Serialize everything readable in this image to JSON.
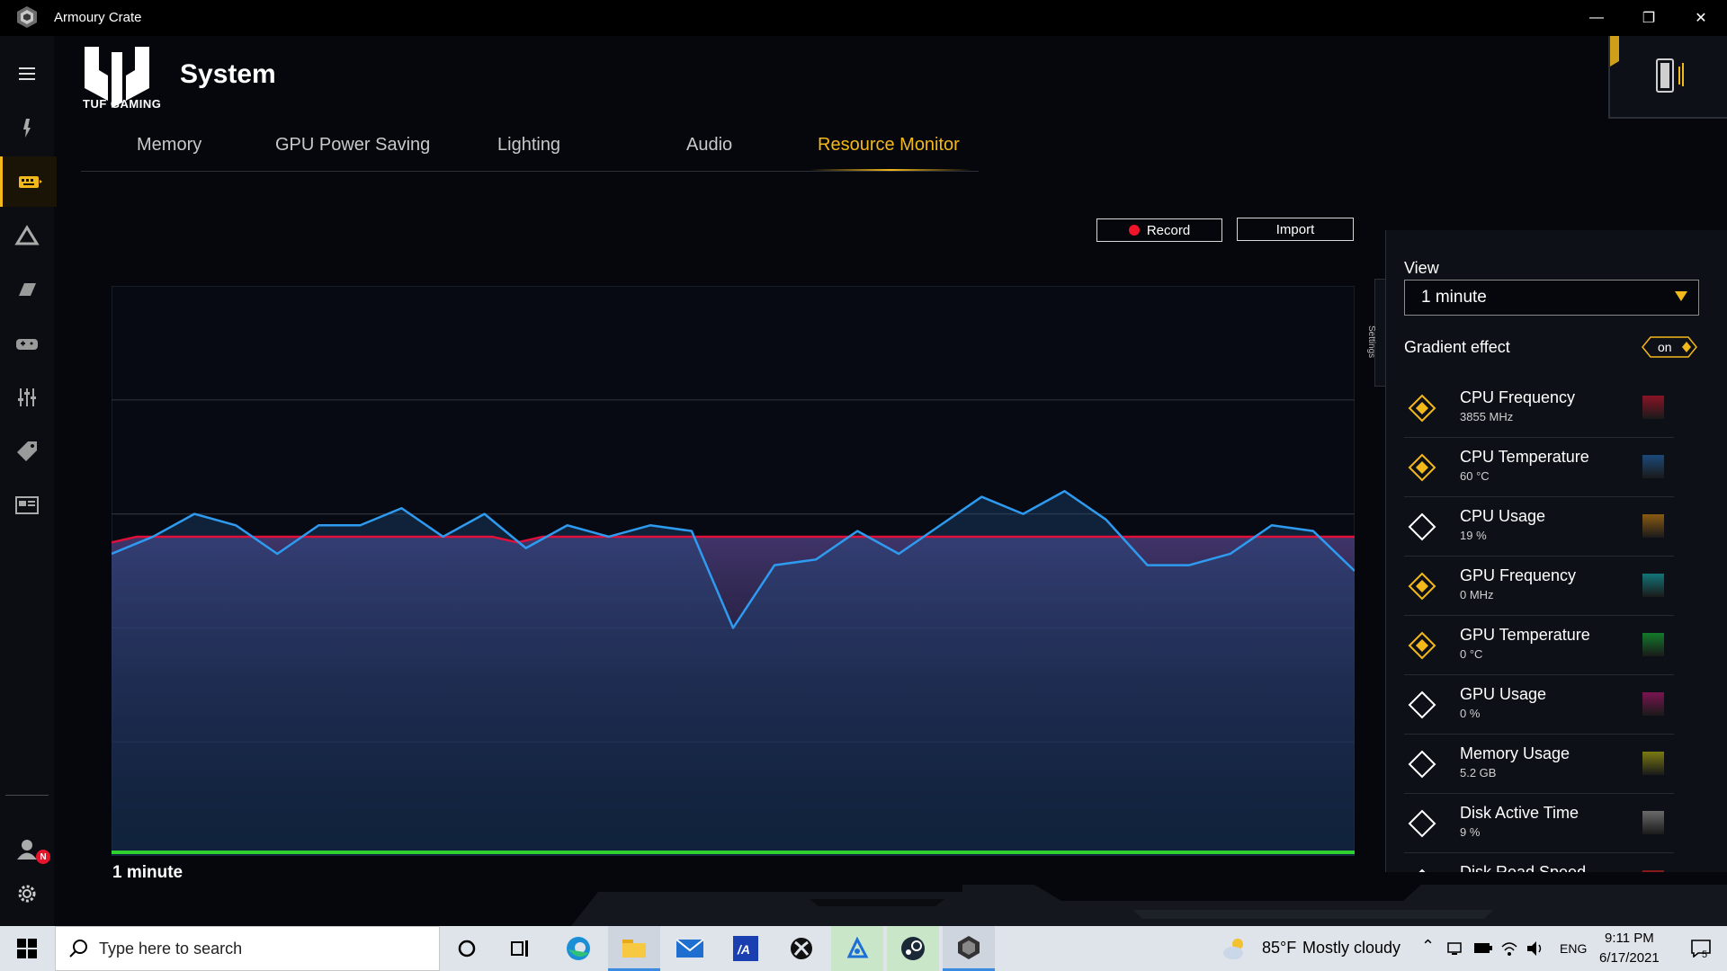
{
  "window": {
    "title": "Armoury Crate",
    "minimize": "—",
    "maximize": "❐",
    "close": "✕"
  },
  "header": {
    "brand": "TUF GAMING",
    "title": "System"
  },
  "tabs": [
    {
      "label": "Memory"
    },
    {
      "label": "GPU Power Saving"
    },
    {
      "label": "Lighting"
    },
    {
      "label": "Audio"
    },
    {
      "label": "Resource Monitor",
      "active": true
    }
  ],
  "toolbar": {
    "record_label": "Record",
    "import_label": "Import"
  },
  "chart": {
    "time_label": "1 minute"
  },
  "chart_data": {
    "type": "area",
    "series": [
      {
        "color": "#e0103a",
        "values": [
          55,
          56,
          56,
          56,
          56,
          56,
          56,
          56,
          56,
          56,
          56,
          56,
          56,
          56,
          56,
          56,
          55,
          56,
          56,
          56,
          56,
          56,
          56,
          56,
          56,
          56,
          56,
          56,
          56,
          56,
          56,
          56,
          56,
          56,
          56,
          56,
          56,
          56,
          56,
          56,
          56,
          56,
          56,
          56,
          56,
          56,
          56,
          56,
          56,
          56
        ]
      },
      {
        "color": "#2e9bf0",
        "values": [
          53,
          56,
          60,
          58,
          53,
          58,
          58,
          61,
          56,
          60,
          54,
          58,
          56,
          58,
          57,
          40,
          51,
          52,
          57,
          53,
          58,
          63,
          60,
          64,
          59,
          51,
          51,
          53,
          58,
          57,
          50
        ]
      }
    ],
    "gridlines": 4,
    "colors": {
      "red": "#e0103a",
      "blue": "#2e9bf0",
      "pink": "#d0306a"
    }
  },
  "panel": {
    "tab_label": "Settings",
    "view_label": "View",
    "view_value": "1  minute",
    "gradient_label": "Gradient effect",
    "gradient_state": "on",
    "metrics": [
      {
        "name": "CPU Frequency",
        "value": "3855 MHz",
        "selected": true,
        "color": "#8a1426"
      },
      {
        "name": "CPU Temperature",
        "value": "60 °C",
        "selected": true,
        "color": "#1a4a7a"
      },
      {
        "name": "CPU Usage",
        "value": "19 %",
        "selected": false,
        "color": "#8a5a12"
      },
      {
        "name": "GPU Frequency",
        "value": "0 MHz",
        "selected": true,
        "color": "#127478"
      },
      {
        "name": "GPU Temperature",
        "value": "0 °C",
        "selected": true,
        "color": "#127a2a"
      },
      {
        "name": "GPU Usage",
        "value": "0 %",
        "selected": false,
        "color": "#7a1450"
      },
      {
        "name": "Memory Usage",
        "value": "5.2 GB",
        "selected": false,
        "color": "#7a7a12"
      },
      {
        "name": "Disk Active Time",
        "value": "9 %",
        "selected": false,
        "color": "#6a6a6a"
      },
      {
        "name": "Disk Read Speed",
        "value": "",
        "selected": false,
        "color": "#8a1a1a"
      }
    ]
  },
  "notification_badge": "N",
  "taskbar": {
    "search_placeholder": "Type here to search",
    "weather_temp": "85°F",
    "weather_text": "Mostly cloudy",
    "language": "ENG",
    "time": "9:11 PM",
    "date": "6/17/2021",
    "notification_count": "5"
  }
}
